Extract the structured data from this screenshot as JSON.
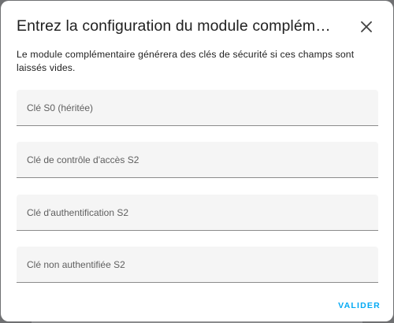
{
  "dialog": {
    "title": "Entrez la configuration du module compléme…",
    "description": "Le module complémentaire générera des clés de sécurité si ces champs sont laissés vides.",
    "close_icon": "close-icon",
    "fields": [
      {
        "placeholder": "Clé S0 (héritée)",
        "value": ""
      },
      {
        "placeholder": "Clé de contrôle d'accès S2",
        "value": ""
      },
      {
        "placeholder": "Clé d'authentification S2",
        "value": ""
      },
      {
        "placeholder": "Clé non authentifiée S2",
        "value": ""
      }
    ],
    "submit_label": "VALIDER"
  },
  "colors": {
    "accent": "#03a9f4",
    "field_background": "#f5f5f5",
    "overlay": "#6f7072"
  }
}
